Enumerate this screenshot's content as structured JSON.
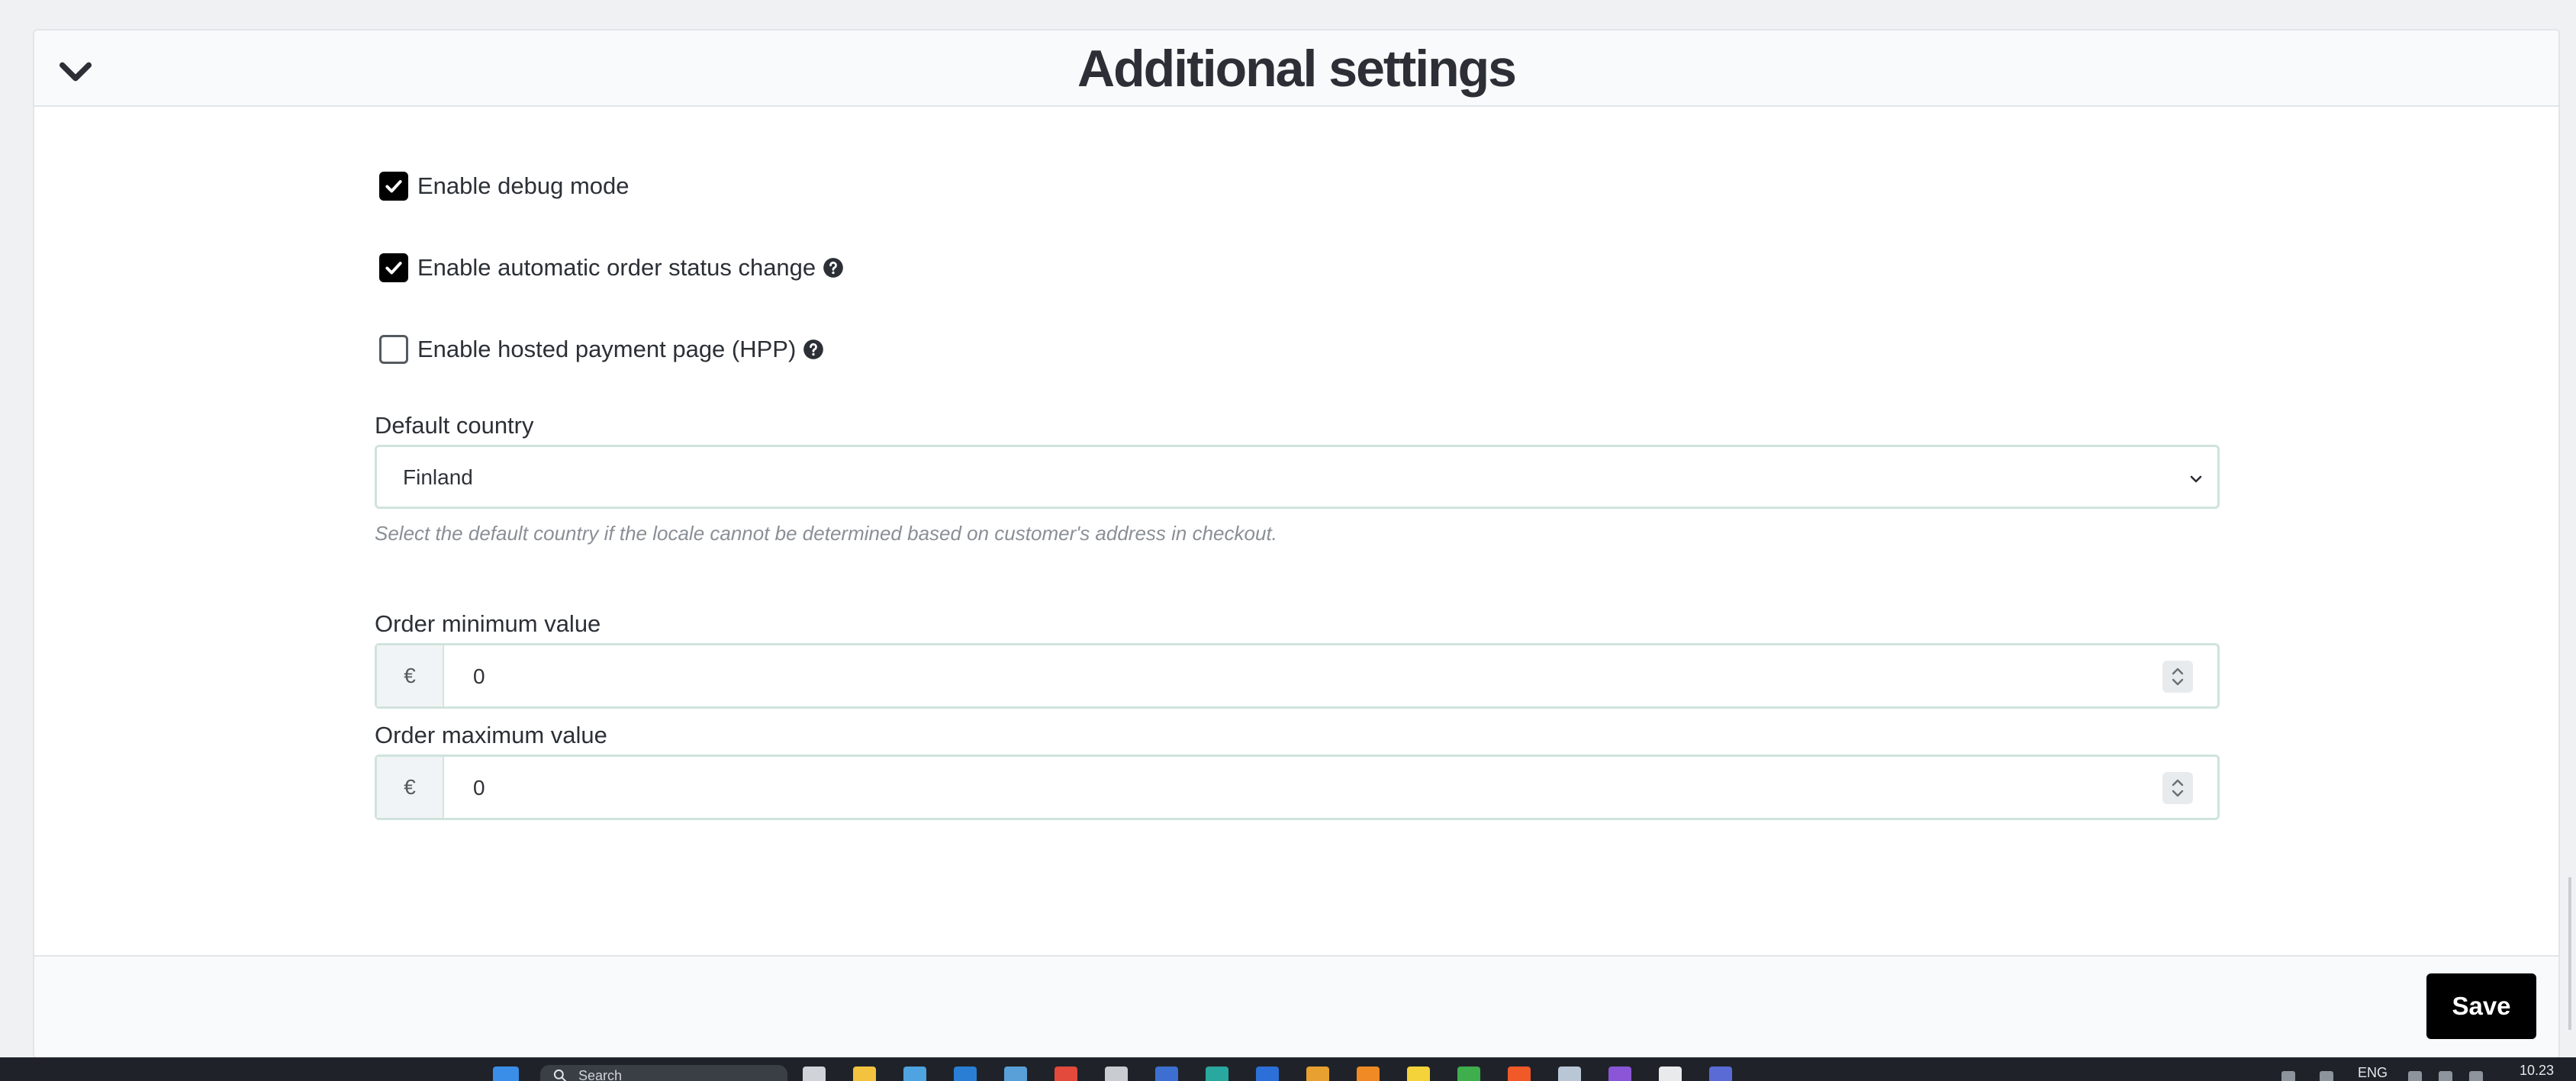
{
  "panel": {
    "title": "Additional settings",
    "collapse_icon": "chevron-down-icon"
  },
  "options": [
    {
      "label": "Enable debug mode",
      "checked": true,
      "help": false
    },
    {
      "label": "Enable automatic order status change",
      "checked": true,
      "help": true
    },
    {
      "label": "Enable hosted payment page (HPP)",
      "checked": false,
      "help": true
    }
  ],
  "default_country": {
    "label": "Default country",
    "value": "Finland",
    "help_text": "Select the default country if the locale cannot be determined based on customer's address in checkout."
  },
  "order_min": {
    "label": "Order minimum value",
    "currency": "€",
    "value": "0"
  },
  "order_max": {
    "label": "Order maximum value",
    "currency": "€",
    "value": "0"
  },
  "footer": {
    "save_label": "Save"
  },
  "taskbar": {
    "search_placeholder": "Search",
    "language": "ENG",
    "time": "10.23"
  },
  "colors": {
    "accent": "#000000",
    "field_border": "#cfe3dc",
    "help_text": "#8a8f96"
  }
}
